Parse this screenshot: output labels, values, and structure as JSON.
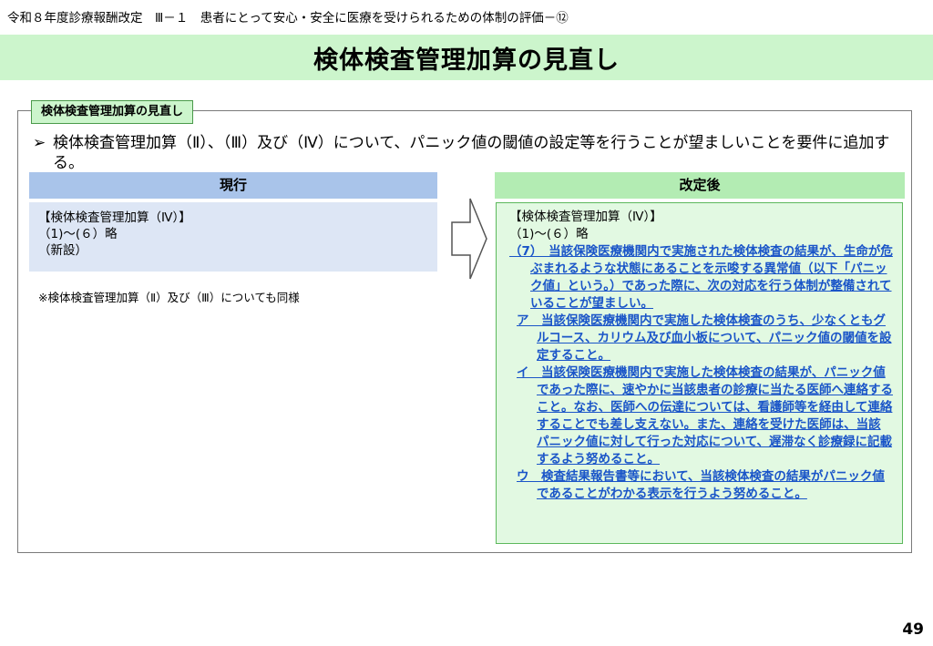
{
  "header": {
    "breadcrumb": "令和８年度診療報酬改定　Ⅲ－１　患者にとって安心・安全に医療を受けられるための体制の評価－⑫",
    "title": "検体検査管理加算の見直し"
  },
  "section": {
    "tag": "検体検査管理加算の見直し",
    "bullet_mark": "➢",
    "bullet_text": "検体検査管理加算（Ⅱ）、（Ⅲ）及び（Ⅳ）について、パニック値の閾値の設定等を行うことが望ましいことを要件に追加する。"
  },
  "current": {
    "header": "現行",
    "lines": [
      "【検体検査管理加算（Ⅳ）】",
      "（1)～(６）略",
      "（新設）"
    ],
    "note": "※検体検査管理加算（Ⅱ）及び（Ⅲ）についても同様"
  },
  "revised": {
    "header": "改定後",
    "line1": "【検体検査管理加算（Ⅳ）】",
    "line2": "（1)～(６）略",
    "item7": "（7）　当該保険医療機関内で実施された検体検査の結果が、生命が危ぶまれるような状態にあることを示唆する異常値（以下「パニック値」という。）であった際に、次の対応を行う体制が整備されていることが望ましい。",
    "sub_a": "ア　当該保険医療機関内で実施した検体検査のうち、少なくともグルコース、カリウム及び血小板について、パニック値の閾値を設定すること。",
    "sub_i": "イ　当該保険医療機関内で実施した検体検査の結果が、パニック値であった際に、速やかに当該患者の診療に当たる医師へ連絡すること。なお、医師への伝達については、看護師等を経由して連絡することでも差し支えない。また、連絡を受けた医師は、当該パニック値に対して行った対応について、遅滞なく診療録に記載するよう努めること。",
    "sub_u": "ウ　検査結果報告書等において、当該検体検査の結果がパニック値であることがわかる表示を行うよう努めること。"
  },
  "page_number": "49"
}
